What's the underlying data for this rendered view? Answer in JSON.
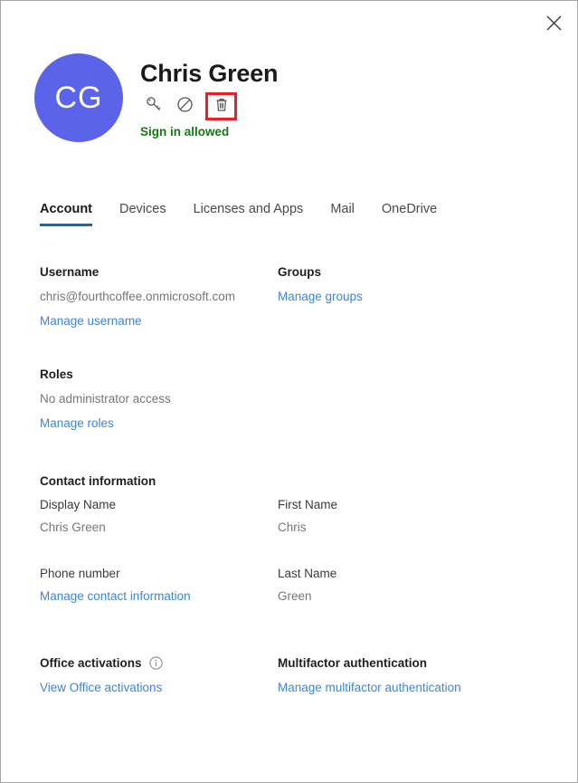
{
  "window": {
    "close_label": "Close",
    "close_icon": "close-icon"
  },
  "colors": {
    "avatar_bg": "#5b64e8",
    "accent": "#0f6cbd",
    "link": "#3b86d6",
    "status_green": "#107c10",
    "highlight_red": "#ee1c25",
    "muted_text": "#767676"
  },
  "header": {
    "avatar_initials": "CG",
    "user_name": "Chris Green",
    "signin_status": "Sign in allowed",
    "actions": [
      {
        "name": "reset-password-icon",
        "label": "Reset password"
      },
      {
        "name": "block-signin-icon",
        "label": "Block sign-in"
      },
      {
        "name": "delete-user-icon",
        "label": "Delete user",
        "highlighted": true
      }
    ]
  },
  "tabs": [
    {
      "label": "Account",
      "active": true
    },
    {
      "label": "Devices",
      "active": false
    },
    {
      "label": "Licenses and Apps",
      "active": false
    },
    {
      "label": "Mail",
      "active": false
    },
    {
      "label": "OneDrive",
      "active": false
    }
  ],
  "sections": {
    "username": {
      "title": "Username",
      "value": "chris@fourthcoffee.onmicrosoft.com",
      "link": "Manage username"
    },
    "groups": {
      "title": "Groups",
      "link": "Manage groups"
    },
    "roles": {
      "title": "Roles",
      "value": "No administrator access",
      "link": "Manage roles"
    },
    "contact": {
      "title": "Contact information",
      "display_name_label": "Display Name",
      "display_name_value": "Chris Green",
      "first_name_label": "First Name",
      "first_name_value": "Chris",
      "phone_label": "Phone number",
      "last_name_label": "Last Name",
      "last_name_value": "Green",
      "link": "Manage contact information"
    },
    "office_activations": {
      "title": "Office activations",
      "info_icon": "info-icon",
      "link": "View Office activations"
    },
    "mfa": {
      "title": "Multifactor authentication",
      "link": "Manage multifactor authentication"
    }
  }
}
